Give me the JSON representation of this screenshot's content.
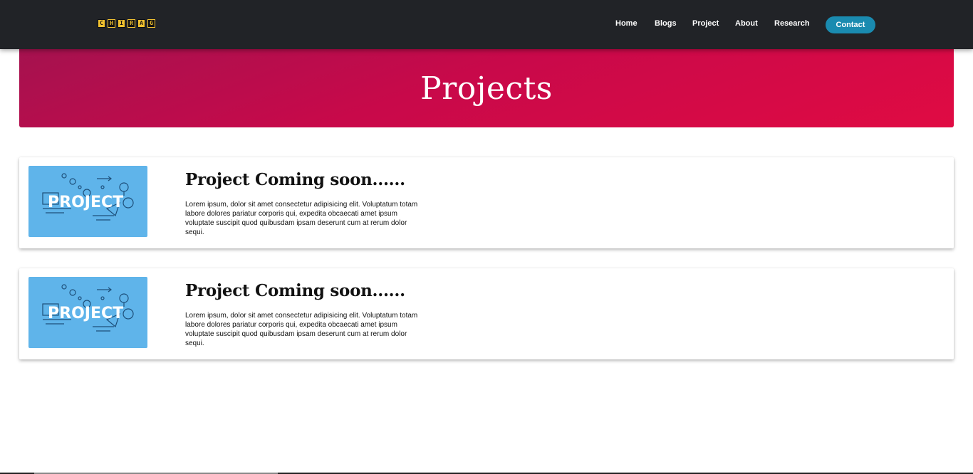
{
  "nav": {
    "logo_letters": [
      "C",
      "H",
      "I",
      "R",
      "A",
      "G"
    ],
    "links": [
      "Home",
      "Blogs",
      "Project",
      "About",
      "Research"
    ],
    "contact_label": "Contact"
  },
  "hero": {
    "title": "Projects"
  },
  "projects": [
    {
      "image_label": "PROJECT",
      "title": "Project Coming soon......",
      "text": "Lorem ipsum, dolor sit amet consectetur adipisicing elit. Voluptatum totam labore dolores pariatur corporis qui, expedita obcaecati amet ipsum voluptate suscipit quod quibusdam ipsam deserunt cum at rerum dolor sequi."
    },
    {
      "image_label": "PROJECT",
      "title": "Project Coming soon......",
      "text": "Lorem ipsum, dolor sit amet consectetur adipisicing elit. Voluptatum totam labore dolores pariatur corporis qui, expedita obcaecati amet ipsum voluptate suscipit quod quibusdam ipsam deserunt cum at rerum dolor sequi."
    }
  ],
  "colors": {
    "navbar": "#212327",
    "accent": "#1a8bb0",
    "hero_gradient": [
      "#a5124f",
      "#e00b43"
    ],
    "image_bg": "#5fb4ea"
  }
}
